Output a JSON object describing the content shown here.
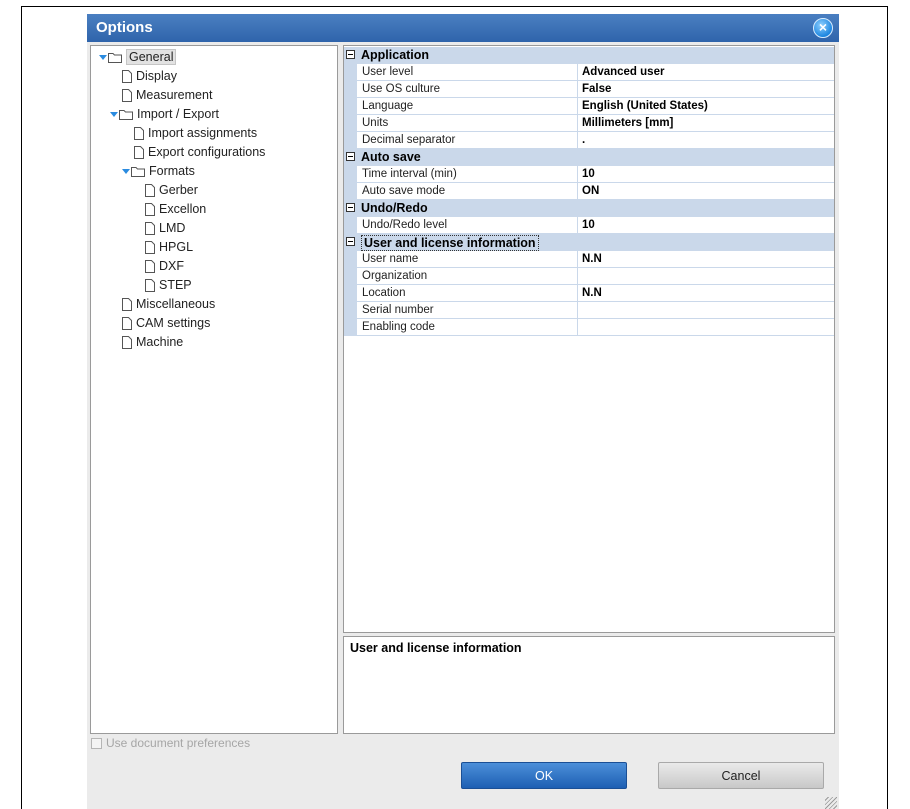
{
  "window": {
    "title": "Options",
    "close_icon": "close-icon"
  },
  "tree": {
    "items": [
      {
        "label": "General",
        "expanded": true,
        "type": "folder",
        "selected": true
      },
      {
        "label": "Display",
        "type": "page"
      },
      {
        "label": "Measurement",
        "type": "page"
      },
      {
        "label": "Import / Export",
        "expanded": true,
        "type": "folder"
      },
      {
        "label": "Import assignments",
        "type": "page"
      },
      {
        "label": "Export configurations",
        "type": "page"
      },
      {
        "label": "Formats",
        "expanded": true,
        "type": "folder"
      },
      {
        "label": "Gerber",
        "type": "page"
      },
      {
        "label": "Excellon",
        "type": "page"
      },
      {
        "label": "LMD",
        "type": "page"
      },
      {
        "label": "HPGL",
        "type": "page"
      },
      {
        "label": "DXF",
        "type": "page"
      },
      {
        "label": "STEP",
        "type": "page"
      },
      {
        "label": "Miscellaneous",
        "type": "page"
      },
      {
        "label": "CAM settings",
        "type": "page"
      },
      {
        "label": "Machine",
        "type": "page"
      }
    ]
  },
  "grid": {
    "categories": [
      {
        "label": "Application",
        "rows": [
          {
            "name": "User level",
            "value": "Advanced user"
          },
          {
            "name": "Use OS culture",
            "value": "False"
          },
          {
            "name": "Language",
            "value": "English (United States)"
          },
          {
            "name": "Units",
            "value": "Millimeters [mm]"
          },
          {
            "name": "Decimal separator",
            "value": "."
          }
        ]
      },
      {
        "label": "Auto save",
        "rows": [
          {
            "name": "Time interval (min)",
            "value": "10"
          },
          {
            "name": "Auto save mode",
            "value": "ON"
          }
        ]
      },
      {
        "label": "Undo/Redo",
        "rows": [
          {
            "name": "Undo/Redo level",
            "value": "10"
          }
        ]
      },
      {
        "label": "User and license information",
        "rows": [
          {
            "name": "User name",
            "value": "N.N"
          },
          {
            "name": "Organization",
            "value": ""
          },
          {
            "name": "Location",
            "value": "N.N"
          },
          {
            "name": "Serial number",
            "value": ""
          },
          {
            "name": "Enabling code",
            "value": ""
          }
        ]
      }
    ]
  },
  "description": {
    "text": "User and license information"
  },
  "footer": {
    "use_doc_prefs_label": "Use document preferences",
    "use_doc_prefs_checked": false,
    "use_doc_prefs_enabled": false,
    "ok_label": "OK",
    "cancel_label": "Cancel"
  },
  "colors": {
    "title_bar": "#2f64ab",
    "category_bg": "#cad8ea",
    "ok_button": "#1d5fb3"
  }
}
